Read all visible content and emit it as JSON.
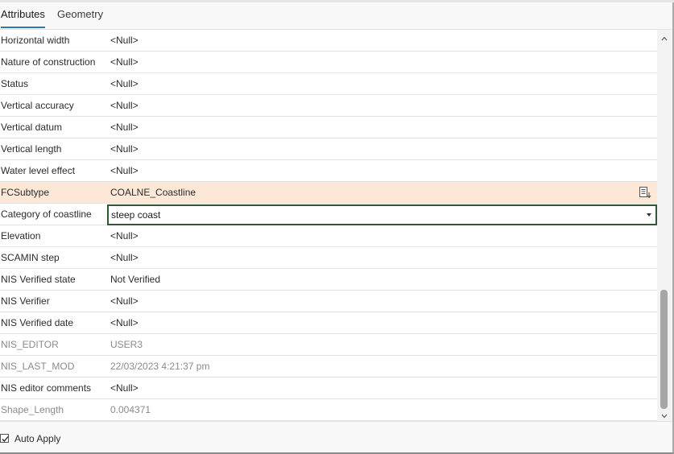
{
  "tabs": [
    {
      "label": "Attributes",
      "active": true
    },
    {
      "label": "Geometry",
      "active": false
    }
  ],
  "rows": [
    {
      "name": "Horizontal width",
      "value": "<Null>"
    },
    {
      "name": "Nature of construction",
      "value": "<Null>"
    },
    {
      "name": "Status",
      "value": "<Null>"
    },
    {
      "name": "Vertical accuracy",
      "value": "<Null>"
    },
    {
      "name": "Vertical datum",
      "value": "<Null>"
    },
    {
      "name": "Vertical length",
      "value": "<Null>"
    },
    {
      "name": "Water level effect",
      "value": "<Null>"
    },
    {
      "name": "FCSubtype",
      "value": "COALNE_Coastline",
      "highlighted": true,
      "icon": "subtype-list-icon"
    },
    {
      "name": "Category of coastline",
      "value": "steep coast",
      "editing": true,
      "control": "dropdown"
    },
    {
      "name": "Elevation",
      "value": "<Null>"
    },
    {
      "name": "SCAMIN step",
      "value": "<Null>"
    },
    {
      "name": "NIS Verified state",
      "value": "Not Verified"
    },
    {
      "name": "NIS Verifier",
      "value": "<Null>"
    },
    {
      "name": "NIS Verified date",
      "value": "<Null>"
    },
    {
      "name": "NIS_EDITOR",
      "value": "USER3",
      "readonly": true
    },
    {
      "name": "NIS_LAST_MOD",
      "value": "22/03/2023 4:21:37 pm",
      "readonly": true
    },
    {
      "name": "NIS editor comments",
      "value": "<Null>"
    },
    {
      "name": "Shape_Length",
      "value": "0.004371",
      "readonly": true
    }
  ],
  "footer": {
    "auto_apply_label": "Auto Apply",
    "auto_apply_checked": true
  },
  "colors": {
    "tab_accent": "#2a7ab3",
    "highlight_row": "#fde8d7",
    "edit_border": "#2f5a2f",
    "readonly_text": "#8a8a8a"
  }
}
